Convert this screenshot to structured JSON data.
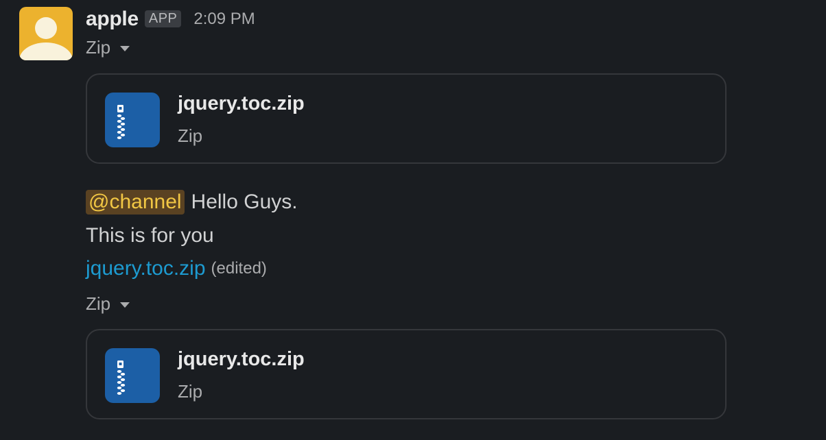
{
  "sender": {
    "name": "apple",
    "badge": "APP",
    "timestamp": "2:09 PM",
    "avatar_color": "#ecb22e"
  },
  "first_file": {
    "toggle_label": "Zip",
    "name": "jquery.toc.zip",
    "type": "Zip",
    "icon": "zip-file-icon",
    "icon_color": "#1c5fa6"
  },
  "message": {
    "mention": "@channel",
    "greeting": "Hello Guys.",
    "line2": "This is for you",
    "link_text": "jquery.toc.zip",
    "edited_label": "(edited)",
    "link_color": "#1d9bd1",
    "mention_color": "#f2c744"
  },
  "second_file": {
    "toggle_label": "Zip",
    "name": "jquery.toc.zip",
    "type": "Zip",
    "icon": "zip-file-icon",
    "icon_color": "#1c5fa6"
  }
}
